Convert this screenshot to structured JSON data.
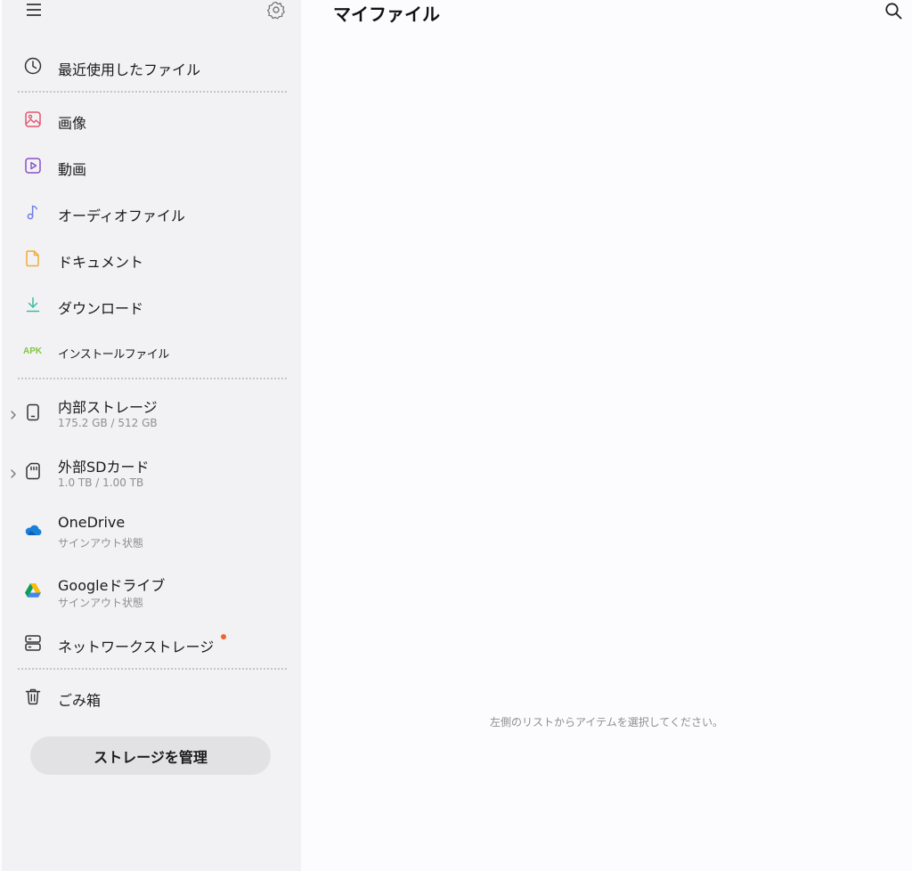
{
  "sidebar": {
    "recent": {
      "label": "最近使用したファイル"
    },
    "categories": [
      {
        "label": "画像"
      },
      {
        "label": "動画"
      },
      {
        "label": "オーディオファイル"
      },
      {
        "label": "ドキュメント"
      },
      {
        "label": "ダウンロード"
      },
      {
        "label": "インストールファイル",
        "icon_text": "APK"
      }
    ],
    "storage": [
      {
        "label": "内部ストレージ",
        "sub": "175.2 GB / 512 GB"
      },
      {
        "label": "外部SDカード",
        "sub": "1.0 TB / 1.00 TB"
      },
      {
        "label": "OneDrive",
        "sub": "サインアウト状態"
      },
      {
        "label": "Googleドライブ",
        "sub": "サインアウト状態"
      },
      {
        "label": "ネットワークストレージ"
      }
    ],
    "trash": {
      "label": "ごみ箱"
    },
    "manage_button": "ストレージを管理"
  },
  "main": {
    "title": "マイファイル",
    "empty_message": "左側のリストからアイテムを選択してください。"
  },
  "icons": {
    "menu": "menu-icon",
    "settings": "gear-icon",
    "search": "search-icon"
  },
  "colors": {
    "sidebar_bg": "#f2f2f4",
    "main_bg": "#fcfcfe",
    "image_icon": "#e5546e",
    "video_icon": "#8a4fc9",
    "audio_icon": "#6f7fe0",
    "document_icon": "#f0a93a",
    "download_icon": "#3bbd9e",
    "apk_icon": "#7fc63d",
    "badge": "#f0642e"
  }
}
